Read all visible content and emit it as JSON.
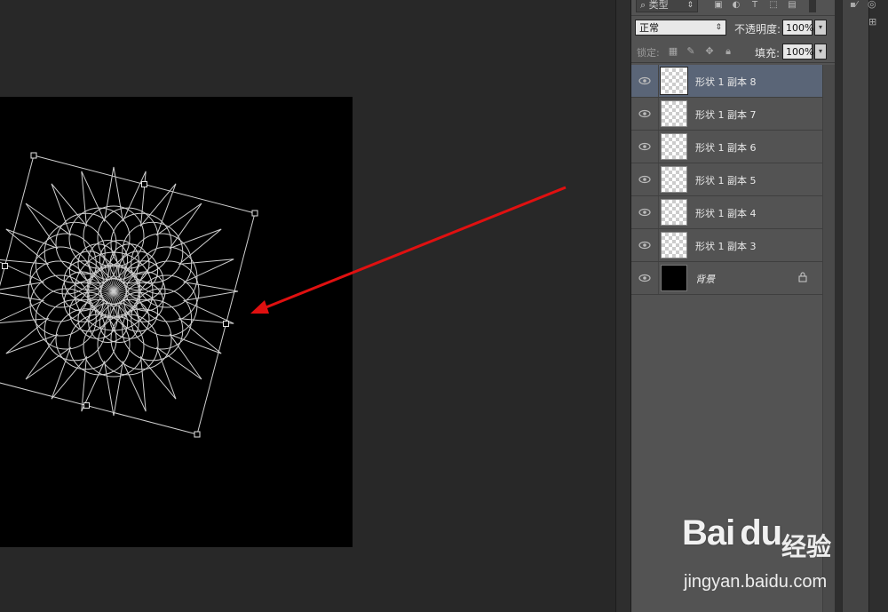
{
  "filter": {
    "kind_label": "类型",
    "kind_caret": "⇕"
  },
  "blend": {
    "mode": "正常",
    "opacity_label": "不透明度:",
    "opacity_value": "100%"
  },
  "lock": {
    "label": "锁定:",
    "fill_label": "填充:",
    "fill_value": "100%"
  },
  "layers": [
    {
      "name": "形状 1 副本 8",
      "selected": true
    },
    {
      "name": "形状 1 副本 7",
      "selected": false
    },
    {
      "name": "形状 1 副本 6",
      "selected": false
    },
    {
      "name": "形状 1 副本 5",
      "selected": false
    },
    {
      "name": "形状 1 副本 4",
      "selected": false
    },
    {
      "name": "形状 1 副本 3",
      "selected": false
    },
    {
      "name": "背景",
      "selected": false,
      "locked": true
    }
  ],
  "watermark": {
    "logo": "Bai",
    "logo_du": "du",
    "sub": "经验",
    "url": "jingyan.baidu.com"
  },
  "colors": {
    "arrow": "#e01010",
    "selected_row": "#5a6577",
    "panel_bg": "#535353"
  }
}
